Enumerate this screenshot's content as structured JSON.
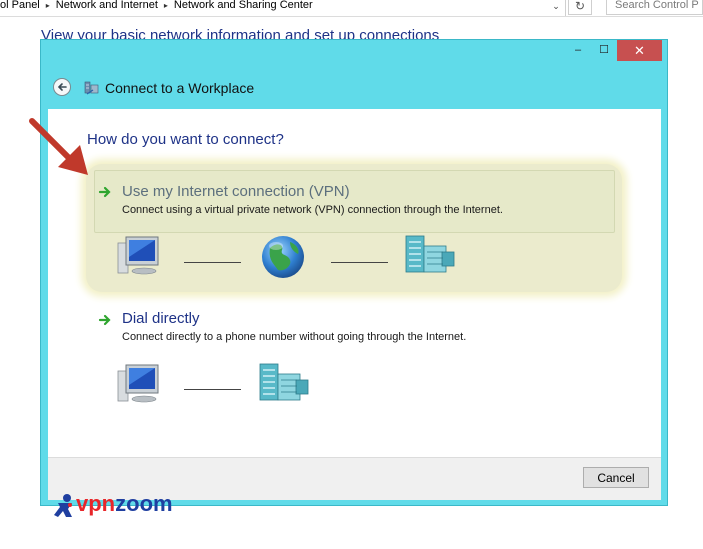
{
  "address_bar": {
    "breadcrumbs": [
      "ol Panel",
      "Network and Internet",
      "Network and Sharing Center"
    ],
    "search_placeholder": "Search Control P",
    "dropdown_glyph": "⌄",
    "refresh_glyph": "↻"
  },
  "background_heading": "View your basic network information and set up connections",
  "dialog": {
    "title": "Connect to a Workplace",
    "minimize_glyph": "–",
    "maximize_glyph": "☐",
    "close_glyph": "✕",
    "question": "How do you want to connect?",
    "options": [
      {
        "title": "Use my Internet connection (VPN)",
        "description": "Connect using a virtual private network (VPN) connection through the Internet.",
        "highlighted": true
      },
      {
        "title": "Dial directly",
        "description": "Connect directly to a phone number without going through the Internet.",
        "highlighted": false
      }
    ],
    "cancel_label": "Cancel"
  },
  "watermark": {
    "text_part1": "vpn",
    "text_part2": "zoom"
  },
  "colors": {
    "dialog_frame": "#60dbe9",
    "heading_blue": "#1e3287",
    "close_red": "#c75050",
    "highlight": "#ebebcd",
    "arrow_red": "#c0392b",
    "green_arrow": "#2fa52f"
  },
  "icons": [
    "back-arrow-icon",
    "network-workplace-icon",
    "green-arrow-icon",
    "computer-icon",
    "globe-icon",
    "office-building-icon"
  ]
}
